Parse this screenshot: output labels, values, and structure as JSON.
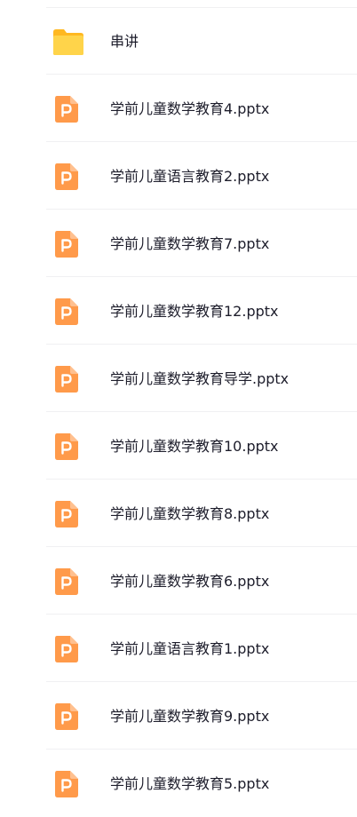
{
  "colors": {
    "ppt_icon": "#ff9a4a",
    "folder_icon": "#ffc93c",
    "text": "#1d1d2b",
    "divider": "#f0f0f2"
  },
  "files": [
    {
      "name": "串讲",
      "type": "folder",
      "icon": "folder-icon"
    },
    {
      "name": "学前儿童数学教育4.pptx",
      "type": "pptx",
      "icon": "ppt-file-icon"
    },
    {
      "name": "学前儿童语言教育2.pptx",
      "type": "pptx",
      "icon": "ppt-file-icon"
    },
    {
      "name": "学前儿童数学教育7.pptx",
      "type": "pptx",
      "icon": "ppt-file-icon"
    },
    {
      "name": "学前儿童数学教育12.pptx",
      "type": "pptx",
      "icon": "ppt-file-icon"
    },
    {
      "name": "学前儿童数学教育导学.pptx",
      "type": "pptx",
      "icon": "ppt-file-icon"
    },
    {
      "name": "学前儿童数学教育10.pptx",
      "type": "pptx",
      "icon": "ppt-file-icon"
    },
    {
      "name": "学前儿童数学教育8.pptx",
      "type": "pptx",
      "icon": "ppt-file-icon"
    },
    {
      "name": "学前儿童数学教育6.pptx",
      "type": "pptx",
      "icon": "ppt-file-icon"
    },
    {
      "name": "学前儿童语言教育1.pptx",
      "type": "pptx",
      "icon": "ppt-file-icon"
    },
    {
      "name": "学前儿童数学教育9.pptx",
      "type": "pptx",
      "icon": "ppt-file-icon"
    },
    {
      "name": "学前儿童数学教育5.pptx",
      "type": "pptx",
      "icon": "ppt-file-icon"
    }
  ]
}
